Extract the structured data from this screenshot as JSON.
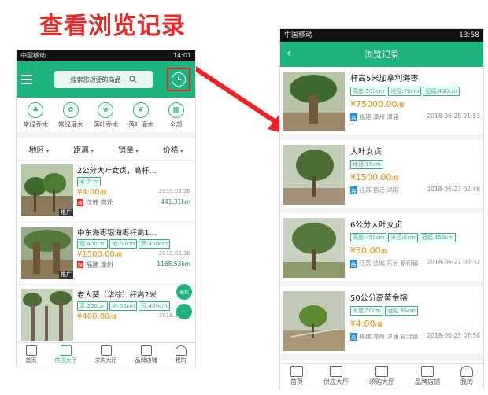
{
  "heading": "查看浏览记录",
  "left_phone": {
    "status": {
      "carrier": "中国移动",
      "time": "14:01"
    },
    "search_placeholder": "搜索您想要的商品",
    "categories": [
      {
        "label": "常绿乔木",
        "icon": "evergreen-tree-icon"
      },
      {
        "label": "常绿灌木",
        "icon": "evergreen-shrub-icon"
      },
      {
        "label": "落叶乔木",
        "icon": "deciduous-tree-icon"
      },
      {
        "label": "落叶灌木",
        "icon": "deciduous-shrub-icon"
      },
      {
        "label": "全部",
        "icon": "grid-icon"
      }
    ],
    "filters": [
      "地区",
      "距离",
      "销量",
      "价格"
    ],
    "items": [
      {
        "title": "2公分大叶女贞，高杆...",
        "tags": [
          "米:2cm"
        ],
        "price": "¥4.00",
        "unit": "/棵",
        "date": "2019.02.26",
        "location": "江苏 宿迁",
        "distance": "441.31km",
        "badge": "推广"
      },
      {
        "title": "中东海枣银海枣杆高1...",
        "tags": [
          "冠:400cm",
          "地:50cm",
          "高:450cm"
        ],
        "price": "¥1500.00",
        "unit": "/棵",
        "date": "2019.03.26",
        "location": "福建 漳州",
        "distance": "1168.53km",
        "badge": "推广"
      },
      {
        "title": "老人葵（华棕）杆高2米",
        "tags": [
          "高:200cm",
          "地:50cm",
          "冠:400cm"
        ],
        "price": "¥400.00",
        "unit": "/棵",
        "date": "2018.10.07",
        "location": "",
        "distance": "",
        "badge": ""
      }
    ],
    "float_publish": "发布",
    "tabs": [
      "首页",
      "供应大厅",
      "求购大厅",
      "品牌店铺",
      "我的"
    ],
    "active_tab": "供应大厅"
  },
  "right_phone": {
    "status": {
      "carrier": "中国移动",
      "time": "13:58"
    },
    "title": "浏览记录",
    "items": [
      {
        "title": "杆高5米加拿利海枣",
        "tags": [
          "高度:500cm",
          "地径:70cm",
          "冠幅:400cm"
        ],
        "price": "¥75000.00",
        "unit": "/棵",
        "location": "福建 漳州 漳浦",
        "date": "2018-06-28 01:53"
      },
      {
        "title": "大叶女贞",
        "tags": [
          "地径:15cm"
        ],
        "price": "¥1500.00",
        "unit": "/棵",
        "location": "江苏 宿迁 沭阳",
        "date": "2018-06-23 02:46"
      },
      {
        "title": "6公分大叶女贞",
        "tags": [
          "高度:450cm",
          "米径:6cm",
          "冠幅:150cm"
        ],
        "price": "¥30.00",
        "unit": "/棵",
        "location": "江苏 盐城 东台 新街镇",
        "date": "2018-06-27 00:31"
      },
      {
        "title": "50公分高黄金榕",
        "tags": [
          "高度:50cm",
          "冠幅:36cm"
        ],
        "price": "¥4.00",
        "unit": "/棵",
        "location": "福建 漳州 漳浦 官浔镇",
        "date": "2018-06-25 07:50"
      }
    ],
    "tabs": [
      "首页",
      "供应大厅",
      "求购大厅",
      "品牌店铺",
      "我的"
    ]
  },
  "colors": {
    "brand": "#1cb47c",
    "price": "#f08a00",
    "heading": "#e52a2a"
  }
}
